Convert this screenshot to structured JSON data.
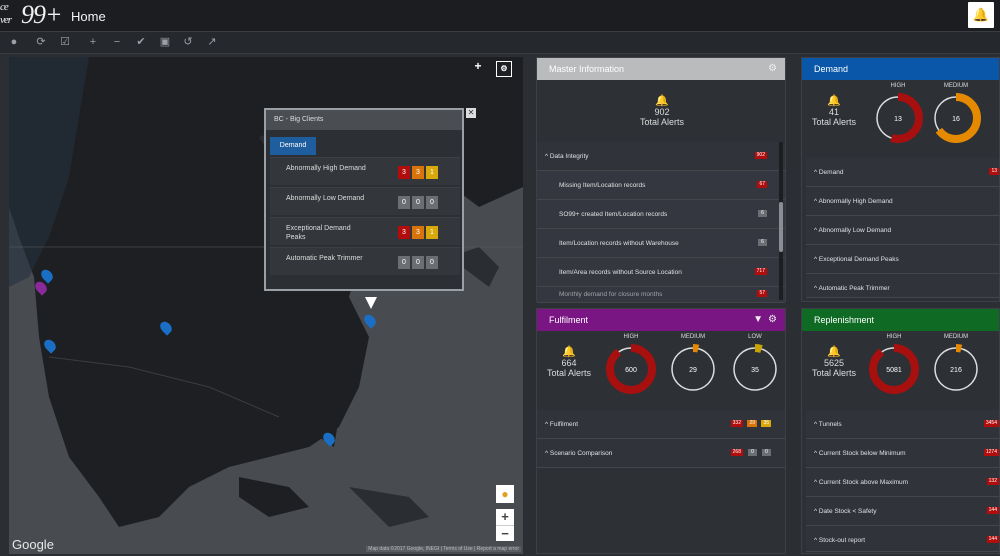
{
  "app": {
    "logo_small_top": "ce",
    "logo_small_bottom": "ver",
    "logo_main": "99+",
    "title": "Home"
  },
  "colors": {
    "high": "#a81010",
    "medium": "#e58a00",
    "low": "#c9a400",
    "demand": "#0a56a8",
    "fulfilment": "#7a1584",
    "replenishment": "#0f6b24",
    "master": "#b9bbbd"
  },
  "toolbar": {
    "icons": [
      "lock-icon",
      "refresh-icon",
      "checkbox-icon",
      "plus-icon",
      "minus-icon",
      "check-circle-icon",
      "save-icon",
      "undo-icon",
      "external-link-icon"
    ]
  },
  "map": {
    "google_label": "Google",
    "attribution": "Map data ©2017 Google, INEGI | Terms of Use | Report a map error",
    "zoom_in": "+",
    "zoom_out": "−",
    "popup": {
      "title": "BC - Big Clients",
      "tab": "Demand",
      "rows": [
        {
          "label": "Abnormally High Demand",
          "values": [
            "3",
            "3",
            "1"
          ],
          "active": true
        },
        {
          "label": "Abnormally Low Demand",
          "values": [
            "0",
            "0",
            "0"
          ],
          "active": false
        },
        {
          "label": "Exceptional Demand Peaks",
          "values": [
            "3",
            "3",
            "1"
          ],
          "active": true
        },
        {
          "label": "Automatic Peak Trimmer",
          "values": [
            "0",
            "0",
            "0"
          ],
          "active": false
        }
      ]
    }
  },
  "master": {
    "title": "Master Information",
    "total": "902",
    "total_label": "Total Alerts",
    "rows": [
      {
        "label": "Data Integrity",
        "badge": "902",
        "sub": false
      },
      {
        "label": "Missing Item/Location records",
        "badge": "67",
        "sub": true
      },
      {
        "label": "SO99+ created Item/Location records",
        "badge": "6",
        "sub": true,
        "grey": true
      },
      {
        "label": "Item/Location records without Warehouse",
        "badge": "6",
        "sub": true,
        "grey": true
      },
      {
        "label": "Item/Area records without Source Location",
        "badge": "717",
        "sub": true
      },
      {
        "label": "Monthly demand for closure months",
        "badge": "57",
        "sub": true
      }
    ]
  },
  "demand": {
    "title": "Demand",
    "total": "41",
    "total_label": "Total Alerts",
    "gauges": [
      {
        "label": "HIGH",
        "value": "13",
        "fill": 0.55
      },
      {
        "label": "MEDIUM",
        "value": "16",
        "fill": 0.65
      }
    ],
    "rows": [
      {
        "label": "Demand",
        "badge": "13"
      },
      {
        "label": "Abnormally High Demand",
        "badge": ""
      },
      {
        "label": "Abnormally Low Demand",
        "badge": ""
      },
      {
        "label": "Exceptional Demand Peaks",
        "badge": ""
      },
      {
        "label": "Automatic Peak Trimmer",
        "badge": ""
      }
    ]
  },
  "fulfilment": {
    "title": "Fulfilment",
    "total": "664",
    "total_label": "Total Alerts",
    "gauges": [
      {
        "label": "HIGH",
        "value": "600",
        "fill": 0.9
      },
      {
        "label": "MEDIUM",
        "value": "29",
        "fill": 0.04
      },
      {
        "label": "LOW",
        "value": "35",
        "fill": 0.05
      }
    ],
    "rows": [
      {
        "label": "Fulfilment",
        "badges": [
          "332",
          "29",
          "35"
        ]
      },
      {
        "label": "Scenario Comparison",
        "badges": [
          "268",
          "0",
          "0"
        ]
      }
    ]
  },
  "replenishment": {
    "title": "Replenishment",
    "total": "5625",
    "total_label": "Total Alerts",
    "gauges": [
      {
        "label": "HIGH",
        "value": "5081",
        "fill": 0.9
      },
      {
        "label": "MEDIUM",
        "value": "216",
        "fill": 0.04
      }
    ],
    "rows": [
      {
        "label": "Tunnels",
        "badge": "3454"
      },
      {
        "label": "Current Stock below Minimum",
        "badge": "1274"
      },
      {
        "label": "Current Stock above Maximum",
        "badge": "132"
      },
      {
        "label": "Date Stock < Safety",
        "badge": "144"
      },
      {
        "label": "Stock-out report",
        "badge": "144"
      }
    ]
  }
}
